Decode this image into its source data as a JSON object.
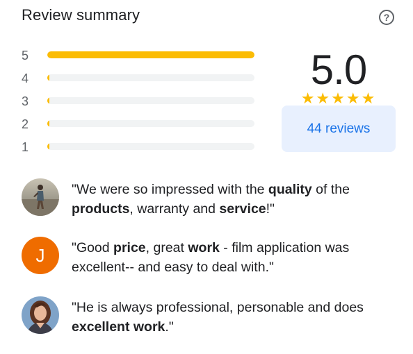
{
  "summary": {
    "title": "Review summary",
    "help_icon": "help-circle-icon",
    "rating": "5.0",
    "stars": "★★★★★",
    "reviews_link": "44 reviews",
    "accent_color": "#fbbc04",
    "link_color": "#1a73e8"
  },
  "distribution": [
    {
      "stars": "5",
      "fraction": 1.0
    },
    {
      "stars": "4",
      "fraction": 0.01
    },
    {
      "stars": "3",
      "fraction": 0.01
    },
    {
      "stars": "2",
      "fraction": 0.01
    },
    {
      "stars": "1",
      "fraction": 0.01
    }
  ],
  "snippets": [
    {
      "avatar_type": "photo",
      "parts": [
        {
          "t": "\"We were so impressed with the ",
          "b": false
        },
        {
          "t": "quality",
          "b": true
        },
        {
          "t": " of the ",
          "b": false
        },
        {
          "t": "products",
          "b": true
        },
        {
          "t": ", warranty and ",
          "b": false
        },
        {
          "t": "service",
          "b": true
        },
        {
          "t": "!\"",
          "b": false
        }
      ]
    },
    {
      "avatar_type": "letter",
      "avatar_letter": "J",
      "avatar_color": "#ef6c00",
      "parts": [
        {
          "t": "\"Good ",
          "b": false
        },
        {
          "t": "price",
          "b": true
        },
        {
          "t": ", great ",
          "b": false
        },
        {
          "t": "work",
          "b": true
        },
        {
          "t": " - film application was excellent-- and easy to deal with.\"",
          "b": false
        }
      ]
    },
    {
      "avatar_type": "photo",
      "parts": [
        {
          "t": "\"He is always professional, personable and does ",
          "b": false
        },
        {
          "t": "excellent work",
          "b": true
        },
        {
          "t": ".\"",
          "b": false
        }
      ]
    }
  ]
}
